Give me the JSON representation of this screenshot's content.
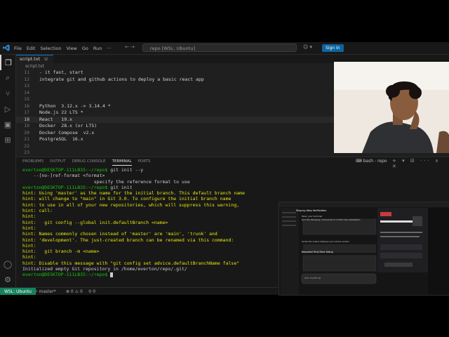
{
  "titlebar": {
    "menu": [
      "File",
      "Edit",
      "Selection",
      "View",
      "Go",
      "Run",
      "···"
    ],
    "nav": "←  →",
    "search": "repo [WSL: Ubuntu]",
    "sign_in": "Sign In"
  },
  "tab": {
    "label": "script.txt",
    "suffix": "U"
  },
  "breadcrumb": "script.txt",
  "editor": {
    "lines": [
      {
        "num": "11",
        "text": "- it fast, start"
      },
      {
        "num": "12",
        "text": "integrate git and github actions to deploy a basic react app"
      },
      {
        "num": "13",
        "text": ""
      },
      {
        "num": "14",
        "text": ""
      },
      {
        "num": "15",
        "text": ""
      },
      {
        "num": "16",
        "text": "Python  3.12.x -> 3.14.4 *"
      },
      {
        "num": "17",
        "text": "Node.js 22 LTS *"
      },
      {
        "num": "18",
        "text": "React   19.x"
      },
      {
        "num": "19",
        "text": "Docker  28.x (or LTS)"
      },
      {
        "num": "20",
        "text": "Docker Compose  v2.x"
      },
      {
        "num": "21",
        "text": "PostgreSQL  16.x"
      },
      {
        "num": "22",
        "text": ""
      },
      {
        "num": "23",
        "text": ""
      }
    ],
    "current_line": "18"
  },
  "panel": {
    "tabs": [
      "PROBLEMS",
      "OUTPUT",
      "DEBUG CONSOLE",
      "TERMINAL",
      "PORTS"
    ],
    "active_tab": "TERMINAL",
    "shell": "bash - repo"
  },
  "terminal": {
    "lines": [
      {
        "kind": "prompt",
        "prompt": "everton@DESKTOP-111LB35:~/repo$",
        "text": " git init --y"
      },
      {
        "kind": "plain",
        "text": "    --[no-]ref-format <format>"
      },
      {
        "kind": "plain",
        "text": "                          specify the reference format to use"
      },
      {
        "kind": "prompt",
        "prompt": "everton@DESKTOP-111LB35:~/repo$",
        "text": " git init"
      },
      {
        "kind": "hint",
        "text": "hint: Using 'master' as the name for the initial branch. This default branch name"
      },
      {
        "kind": "hint",
        "text": "hint: will change to \"main\" in Git 3.0. To configure the initial branch name"
      },
      {
        "kind": "hint",
        "text": "hint: to use in all of your new repositories, which will suppress this warning,"
      },
      {
        "kind": "hint",
        "text": "hint: call:"
      },
      {
        "kind": "hint",
        "text": "hint:"
      },
      {
        "kind": "hint",
        "text": "hint:   git config --global init.defaultBranch <name>"
      },
      {
        "kind": "hint",
        "text": "hint:"
      },
      {
        "kind": "hint",
        "text": "hint: Names commonly chosen instead of 'master' are 'main', 'trunk' and"
      },
      {
        "kind": "hint",
        "text": "hint: 'development'. The just-created branch can be renamed via this command:"
      },
      {
        "kind": "hint",
        "text": "hint:"
      },
      {
        "kind": "hint",
        "text": "hint:   git branch -m <name>"
      },
      {
        "kind": "hint",
        "text": "hint:"
      },
      {
        "kind": "hint",
        "text": "hint: Disable this message with \"git config set advice.defaultBranchName false\""
      },
      {
        "kind": "plain",
        "text": "Initialized empty Git repository in /home/everton/repo/.git/"
      },
      {
        "kind": "prompt",
        "prompt": "everton@DESKTOP-111LB35:~/repo$",
        "text": " ",
        "cursor": true
      }
    ]
  },
  "statusbar": {
    "remote": "WSL: Ubuntu",
    "branch": "master*",
    "errors": "⊗ 0  ⚠ 0",
    "ports": "⚲ 0"
  },
  "shared_screen": {
    "heading": "Step-by-Step Verification",
    "items": [
      "Open your terminal",
      "Run the following commands to confirm the installation:",
      "Verify the output displays your active version",
      "Required First-Time Setup"
    ],
    "input_placeholder": "Ask anything"
  },
  "colors": {
    "accent": "#0078d4",
    "remote": "#16825d",
    "prompt": "#16c60c",
    "hint": "#e5e510"
  }
}
